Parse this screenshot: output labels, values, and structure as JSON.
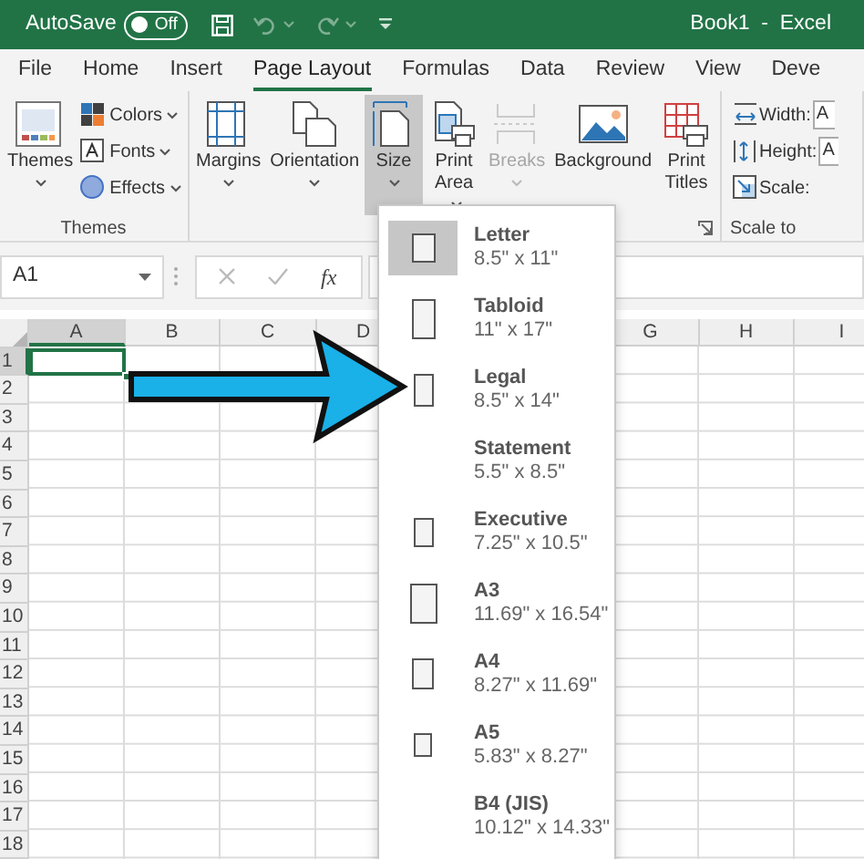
{
  "title_bar": {
    "autosave": {
      "label": "AutoSave",
      "toggle_text": "Off",
      "on": false
    },
    "title": "Book1  -  Excel"
  },
  "tabs": [
    {
      "label": "File",
      "selected": false
    },
    {
      "label": "Home",
      "selected": false
    },
    {
      "label": "Insert",
      "selected": false
    },
    {
      "label": "Page Layout",
      "selected": true
    },
    {
      "label": "Formulas",
      "selected": false
    },
    {
      "label": "Data",
      "selected": false
    },
    {
      "label": "Review",
      "selected": false
    },
    {
      "label": "View",
      "selected": false
    },
    {
      "label": "Deve",
      "selected": false
    }
  ],
  "ribbon": {
    "groups": [
      {
        "label": "Themes",
        "commands": [
          {
            "kind": "large",
            "label": "Themes",
            "menu": true,
            "selected": false,
            "disabled": false
          },
          {
            "kind": "small",
            "label": "Colors",
            "menu": true
          },
          {
            "kind": "small",
            "label": "Fonts",
            "menu": true
          },
          {
            "kind": "small",
            "label": "Effects",
            "menu": true
          }
        ]
      },
      {
        "launcher": true,
        "commands": [
          {
            "kind": "large",
            "label": "Margins",
            "menu": true,
            "selected": false,
            "disabled": false
          },
          {
            "kind": "large",
            "label": "Orientation",
            "menu": true,
            "selected": false,
            "disabled": false
          },
          {
            "kind": "large",
            "label": "Size",
            "menu": true,
            "selected": true,
            "disabled": false
          },
          {
            "kind": "large_two_line",
            "label": "Print Area",
            "menu": true,
            "selected": false,
            "disabled": false
          },
          {
            "kind": "large",
            "label": "Breaks",
            "menu": true,
            "selected": false,
            "disabled": true
          },
          {
            "kind": "large",
            "label": "Background",
            "menu": false,
            "selected": false,
            "disabled": false
          },
          {
            "kind": "large_two_line",
            "label": "Print Titles",
            "menu": false,
            "selected": false,
            "disabled": false
          }
        ]
      },
      {
        "label": "Scale to",
        "commands": [
          {
            "kind": "field",
            "label": "Width:",
            "value": "A"
          },
          {
            "kind": "field",
            "label": "Height:",
            "value": "A"
          },
          {
            "kind": "field",
            "label": "Scale:"
          }
        ]
      }
    ]
  },
  "formula_bar": {
    "name_box": "A1",
    "function_button": "fx"
  },
  "sheet": {
    "columns": [
      {
        "label": "A",
        "selected": true
      },
      {
        "label": "B",
        "selected": false
      },
      {
        "label": "C",
        "selected": false
      },
      {
        "label": "D",
        "selected": false
      },
      {
        "label": "G",
        "selected": false
      },
      {
        "label": "H",
        "selected": false
      },
      {
        "label": "I",
        "selected": false
      }
    ],
    "rows": [
      {
        "label": "1",
        "selected": true
      },
      {
        "label": "2",
        "selected": false
      },
      {
        "label": "3",
        "selected": false
      },
      {
        "label": "4",
        "selected": false
      },
      {
        "label": "5",
        "selected": false
      },
      {
        "label": "6",
        "selected": false
      },
      {
        "label": "7",
        "selected": false
      },
      {
        "label": "8",
        "selected": false
      },
      {
        "label": "9",
        "selected": false
      },
      {
        "label": "10",
        "selected": false
      },
      {
        "label": "11",
        "selected": false
      },
      {
        "label": "12",
        "selected": false
      },
      {
        "label": "13",
        "selected": false
      },
      {
        "label": "14",
        "selected": false
      },
      {
        "label": "15",
        "selected": false
      },
      {
        "label": "16",
        "selected": false
      },
      {
        "label": "17",
        "selected": false
      },
      {
        "label": "18",
        "selected": false
      }
    ]
  },
  "size_menu": {
    "items": [
      {
        "kind": "page",
        "name": "Letter",
        "size": "8.5\" x 11\"",
        "selected": true
      },
      {
        "kind": "page",
        "name": "Tabloid",
        "size": "11\" x 17\"",
        "selected": false
      },
      {
        "kind": "page",
        "name": "Legal",
        "size": "8.5\" x 14\"",
        "selected": false
      },
      {
        "kind": "plain",
        "name": "Statement",
        "size": "5.5\" x 8.5\"",
        "selected": false
      },
      {
        "kind": "page",
        "name": "Executive",
        "size": "7.25\" x 10.5\"",
        "selected": false
      },
      {
        "kind": "page",
        "name": "A3",
        "size": "11.69\" x 16.54\"",
        "selected": false
      },
      {
        "kind": "page",
        "name": "A4",
        "size": "8.27\" x 11.69\"",
        "selected": false
      },
      {
        "kind": "page",
        "name": "A5",
        "size": "5.83\" x 8.27\"",
        "selected": false
      },
      {
        "kind": "plain",
        "name": "B4 (JIS)",
        "size": "10.12\" x 14.33\"",
        "selected": false
      }
    ]
  },
  "annotation": {
    "kind": "arrow"
  }
}
